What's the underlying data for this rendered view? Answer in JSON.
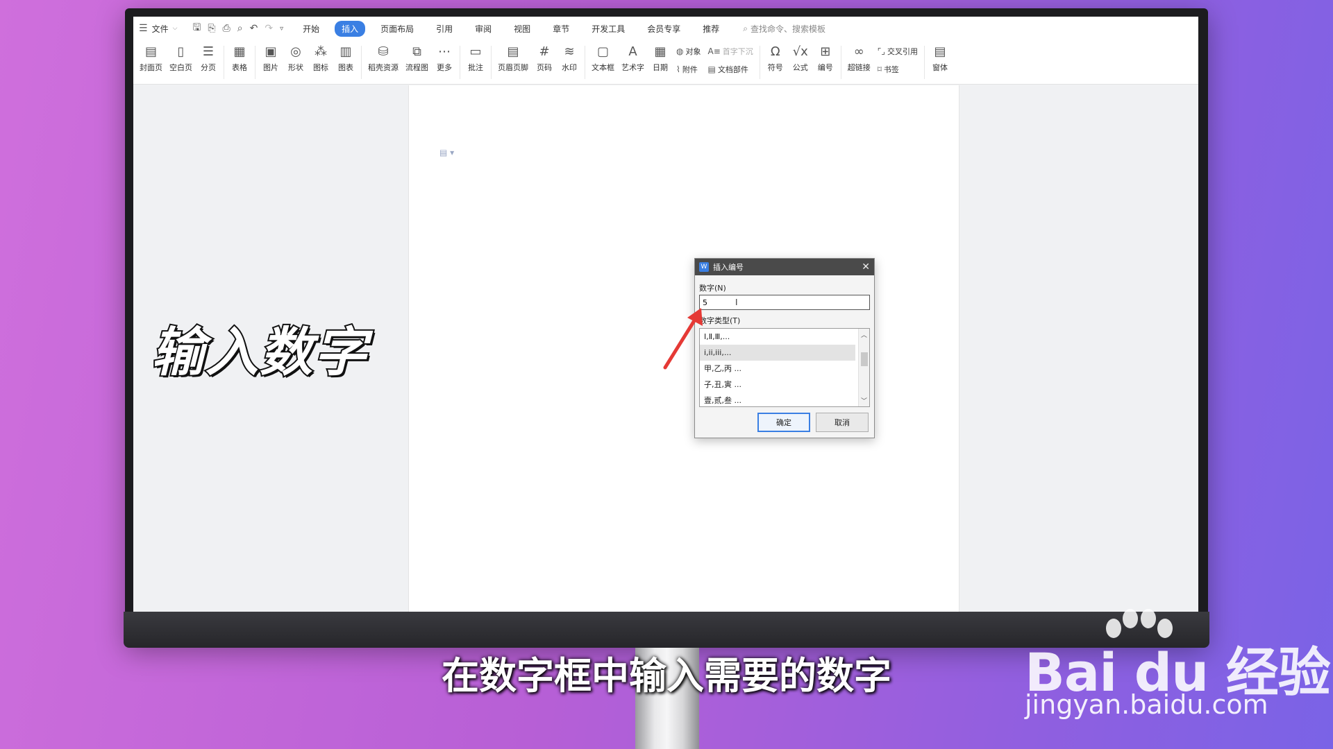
{
  "menubar": {
    "file_label": "文件",
    "tabs": [
      {
        "label": "开始",
        "active": false
      },
      {
        "label": "插入",
        "active": true
      },
      {
        "label": "页面布局",
        "active": false
      },
      {
        "label": "引用",
        "active": false
      },
      {
        "label": "审阅",
        "active": false
      },
      {
        "label": "视图",
        "active": false
      },
      {
        "label": "章节",
        "active": false
      },
      {
        "label": "开发工具",
        "active": false
      },
      {
        "label": "会员专享",
        "active": false
      },
      {
        "label": "推荐",
        "active": false
      }
    ],
    "search_placeholder": "查找命令、搜索模板"
  },
  "ribbon": {
    "cover_page": "封面页",
    "blank_page": "空白页",
    "page_break": "分页",
    "table": "表格",
    "picture": "图片",
    "shape": "形状",
    "icon_lib": "图标",
    "chart": "图表",
    "docer_resources": "稻壳资源",
    "flowchart": "流程图",
    "more": "更多",
    "comment": "批注",
    "header_footer": "页眉页脚",
    "page_number": "页码",
    "watermark": "水印",
    "text_box": "文本框",
    "word_art": "艺术字",
    "date": "日期",
    "object": "对象",
    "attachment": "附件",
    "drop_cap": "首字下沉",
    "doc_parts": "文档部件",
    "symbol": "符号",
    "formula": "公式",
    "numbering": "编号",
    "hyperlink": "超链接",
    "cross_reference": "交叉引用",
    "bookmark": "书签",
    "window": "窗体"
  },
  "dialog": {
    "app_icon": "W",
    "title": "插入编号",
    "number_label": "数字(N)",
    "number_value": "5",
    "type_label": "数字类型(T)",
    "types": [
      {
        "label": "Ⅰ,Ⅱ,Ⅲ,...",
        "selected": false
      },
      {
        "label": "i,ii,iii,...",
        "selected": true
      },
      {
        "label": "甲,乙,丙 ...",
        "selected": false
      },
      {
        "label": "子,丑,寅 ...",
        "selected": false
      },
      {
        "label": "壹,贰,叁 ...",
        "selected": false
      }
    ],
    "ok_label": "确定",
    "cancel_label": "取消"
  },
  "overlay": {
    "big_caption": "输入数字",
    "subtitle": "在数字框中输入需要的数字",
    "watermark_brand": "Bai du 经验",
    "watermark_url": "jingyan.baidu.com"
  },
  "colors": {
    "accent": "#3a7fe3",
    "arrow": "#e53935",
    "background_left": "#cf6fdc",
    "background_right": "#7a63e6"
  },
  "icons": {
    "menu": "hamburger-icon",
    "search": "search-icon",
    "close": "close-icon"
  }
}
